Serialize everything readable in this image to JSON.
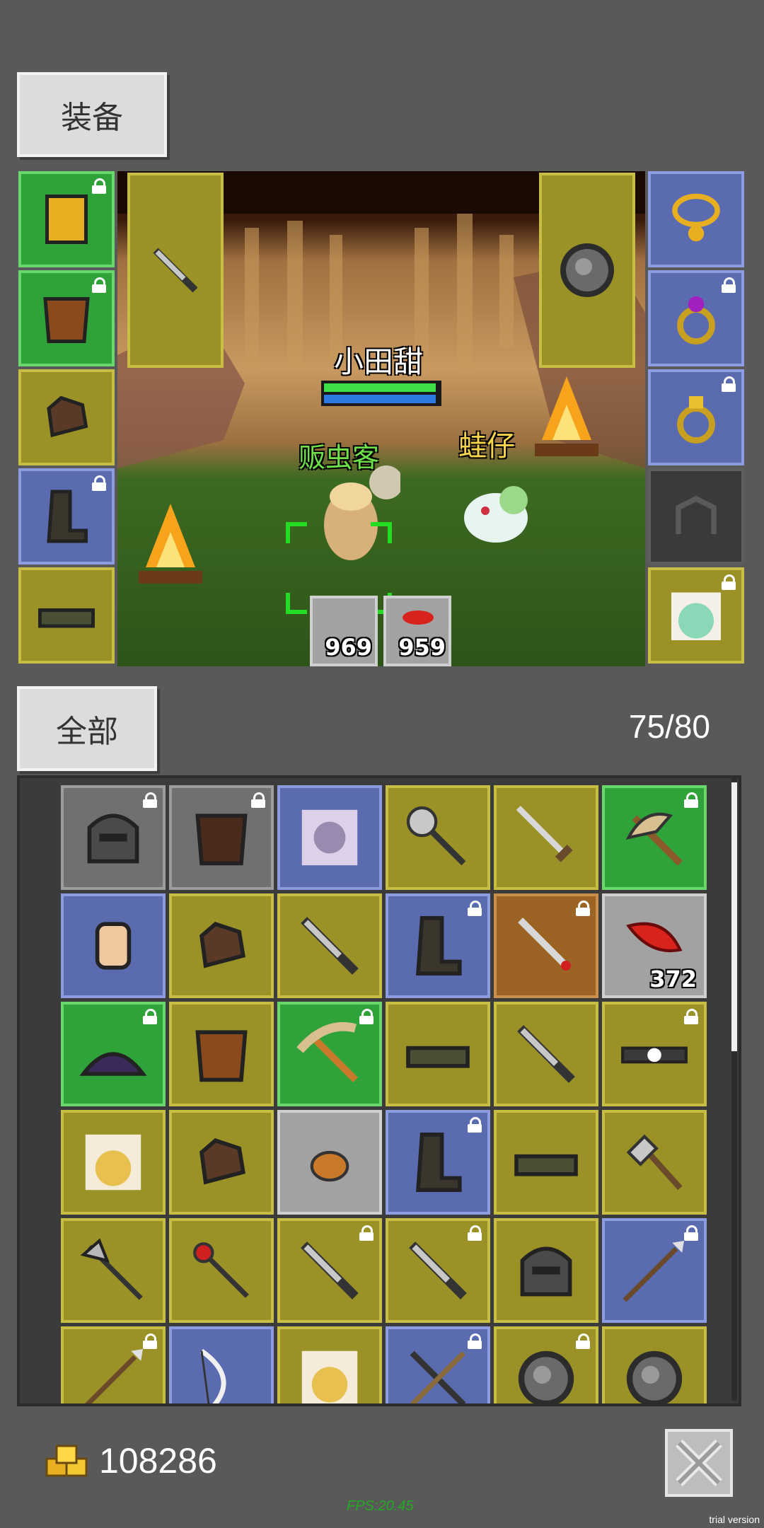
{
  "equipment_tab": {
    "label": "装备"
  },
  "scene": {
    "player_name": "小田甜",
    "npc_name": "贩虫客",
    "pet_name": "蛙仔",
    "stat_left": "969",
    "stat_right": "959"
  },
  "inventory_tab": {
    "label": "全部"
  },
  "capacity": "75/80",
  "gold": {
    "amount": "108286",
    "icon": "gold-coins-icon"
  },
  "fps": "FPS:20.45",
  "watermark": "trial version",
  "close_icon": "close-x-icon",
  "colors": {
    "background": "#595959",
    "green_rarity": "#2fa23a",
    "blue_rarity": "#5a6bb0",
    "olive_rarity": "#9a9226",
    "fps_text": "#22aa22"
  },
  "equip_left": [
    {
      "rarity": "green",
      "item": "armor-icon",
      "locked": true
    },
    {
      "rarity": "green",
      "item": "chest-icon",
      "locked": true
    },
    {
      "rarity": "olive",
      "item": "gloves-icon",
      "locked": false
    },
    {
      "rarity": "blue",
      "item": "boots-icon",
      "locked": true
    },
    {
      "rarity": "olive",
      "item": "belt-icon",
      "locked": false
    }
  ],
  "equip_right": [
    {
      "rarity": "blue",
      "item": "necklace-icon",
      "locked": false
    },
    {
      "rarity": "blue",
      "item": "ring-purple-icon",
      "locked": true
    },
    {
      "rarity": "blue",
      "item": "ring-gold-icon",
      "locked": true
    },
    {
      "rarity": "black",
      "item": "mount-slot-icon",
      "locked": false
    },
    {
      "rarity": "olive",
      "item": "pet-portrait-icon",
      "locked": true
    }
  ],
  "inventory": [
    {
      "rarity": "dark",
      "item": "helmet-icon",
      "locked": true
    },
    {
      "rarity": "dark",
      "item": "armor-dark-icon",
      "locked": true
    },
    {
      "rarity": "blue",
      "item": "portrait-icon",
      "locked": false
    },
    {
      "rarity": "olive",
      "item": "mace-icon",
      "locked": false
    },
    {
      "rarity": "olive",
      "item": "sword-icon",
      "locked": false
    },
    {
      "rarity": "green",
      "item": "axe-icon",
      "locked": true
    },
    {
      "rarity": "blue",
      "item": "scroll-icon",
      "locked": false
    },
    {
      "rarity": "olive",
      "item": "gloves-icon",
      "locked": false
    },
    {
      "rarity": "olive",
      "item": "dagger-icon",
      "locked": false
    },
    {
      "rarity": "blue",
      "item": "boots-icon",
      "locked": true
    },
    {
      "rarity": "orange",
      "item": "sword-red-icon",
      "locked": true
    },
    {
      "rarity": "gray",
      "item": "red-feather-icon",
      "locked": false,
      "count": "372"
    },
    {
      "rarity": "green",
      "item": "helmet-purple-icon",
      "locked": true
    },
    {
      "rarity": "olive",
      "item": "chest-icon",
      "locked": false
    },
    {
      "rarity": "green",
      "item": "pickaxe-icon",
      "locked": true
    },
    {
      "rarity": "olive",
      "item": "belt-icon",
      "locked": false
    },
    {
      "rarity": "olive",
      "item": "dagger-icon",
      "locked": false
    },
    {
      "rarity": "olive",
      "item": "belt-ring-icon",
      "locked": true
    },
    {
      "rarity": "olive",
      "item": "portrait-bird-icon",
      "locked": false
    },
    {
      "rarity": "olive",
      "item": "gloves-icon",
      "locked": false
    },
    {
      "rarity": "gray",
      "item": "ore-icon",
      "locked": false
    },
    {
      "rarity": "blue",
      "item": "boots-icon",
      "locked": true
    },
    {
      "rarity": "olive",
      "item": "belt-icon",
      "locked": false
    },
    {
      "rarity": "olive",
      "item": "axe-small-icon",
      "locked": false
    },
    {
      "rarity": "olive",
      "item": "halberd-icon",
      "locked": false
    },
    {
      "rarity": "olive",
      "item": "staff-icon",
      "locked": false
    },
    {
      "rarity": "olive",
      "item": "dagger-icon",
      "locked": true
    },
    {
      "rarity": "olive",
      "item": "dagger-icon",
      "locked": true
    },
    {
      "rarity": "olive",
      "item": "helmet-icon",
      "locked": false
    },
    {
      "rarity": "blue",
      "item": "spear-icon",
      "locked": true
    },
    {
      "rarity": "olive",
      "item": "spear-icon",
      "locked": true
    },
    {
      "rarity": "blue",
      "item": "bow-icon",
      "locked": false
    },
    {
      "rarity": "olive",
      "item": "portrait-bird-icon",
      "locked": false
    },
    {
      "rarity": "blue",
      "item": "crossbow-icon",
      "locked": true
    },
    {
      "rarity": "olive",
      "item": "shield-icon",
      "locked": true
    },
    {
      "rarity": "olive",
      "item": "shield-icon",
      "locked": false
    }
  ]
}
